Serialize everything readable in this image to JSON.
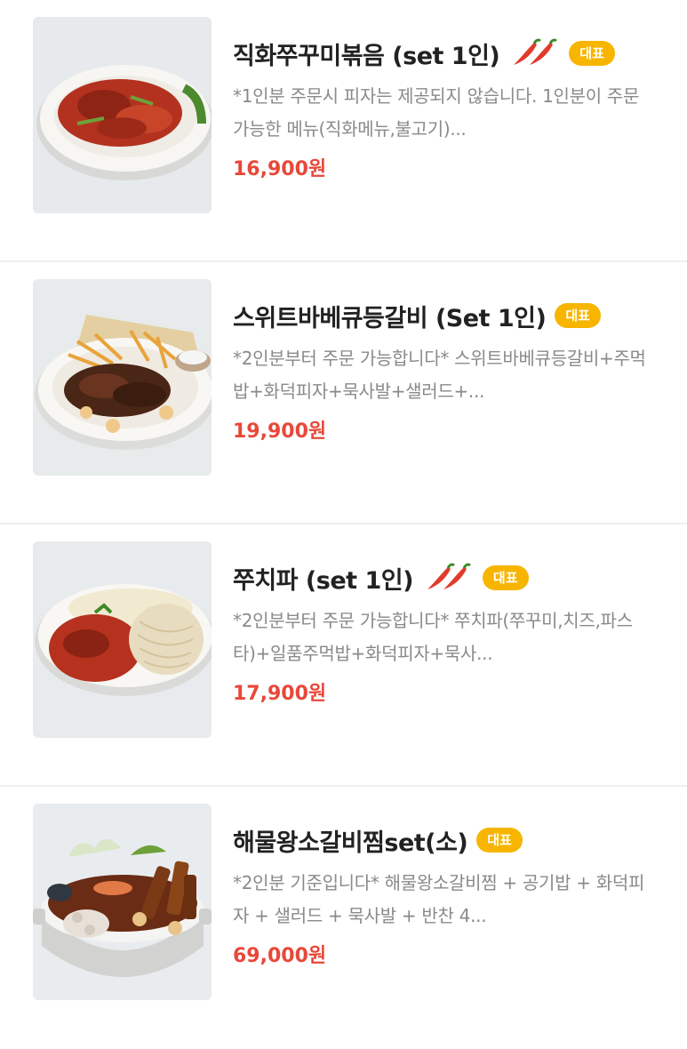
{
  "colors": {
    "price": "#e8483a",
    "badge": "#f7b500",
    "desc": "#8a8a8a"
  },
  "items": [
    {
      "name": "직화쭈꾸미볶음 (set 1인)",
      "spicy_icon": "chili-pepper-icon",
      "badge": "대표",
      "description": "*1인분 주문시 피자는 제공되지 않습니다. 1인분이 주문 가능한 메뉴(직화메뉴,불고기)...",
      "price": "16,900원"
    },
    {
      "name": "스위트바베큐등갈비 (Set 1인)",
      "badge": "대표",
      "description": "*2인분부터 주문 가능합니다* 스위트바베큐등갈비+주먹밥+화덕피자+묵사발+샐러드+...",
      "price": "19,900원"
    },
    {
      "name": "쭈치파 (set 1인)",
      "spicy_icon": "chili-pepper-icon",
      "badge": "대표",
      "description": "*2인분부터 주문 가능합니다* 쭈치파(쭈꾸미,치즈,파스타)+일품주먹밥+화덕피자+묵사...",
      "price": "17,900원"
    },
    {
      "name": "해물왕소갈비찜set(소)",
      "badge": "대표",
      "description": "*2인분 기준입니다* 해물왕소갈비찜 + 공기밥 + 화덕피자 + 샐러드 + 묵사발 + 반찬 4...",
      "price": "69,000원"
    }
  ]
}
